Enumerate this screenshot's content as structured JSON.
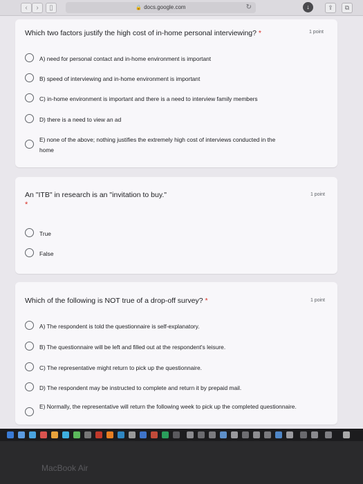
{
  "browser": {
    "url": "docs.google.com"
  },
  "questions": [
    {
      "title": "Which two factors justify the high cost of in-home personal interviewing?",
      "required_mark": "*",
      "points": "1 point",
      "options": [
        "A) need for personal contact and in-home environment is important",
        "B) speed of interviewing and in-home environment is important",
        "C) in-home environment is important and there is a need to interview family members",
        "D) there is a need to view an ad",
        "E) none of the above; nothing justifies the extremely high cost of interviews conducted in the home"
      ]
    },
    {
      "title": "An \"ITB\" in research is an \"invitation to buy.\"",
      "required_mark": "*",
      "points": "1 point",
      "options": [
        "True",
        "False"
      ]
    },
    {
      "title": "Which of the following is NOT true of a drop-off survey?",
      "required_mark": "*",
      "points": "1 point",
      "options": [
        "A) The respondent is told the questionnaire is self-explanatory.",
        "B) The questionnaire will be left and filled out at the respondent's leisure.",
        "C) The representative might return to pick up the questionnaire.",
        "D) The respondent may be instructed to complete and return it by prepaid mail.",
        "E) Normally, the representative will return the following week to pick up the completed questionnaire."
      ]
    }
  ],
  "device": {
    "brand": "MacBook Air"
  },
  "colors": {
    "required": "#d93025",
    "card_bg": "#f8f7fa",
    "page_bg": "#e9e7ec"
  }
}
